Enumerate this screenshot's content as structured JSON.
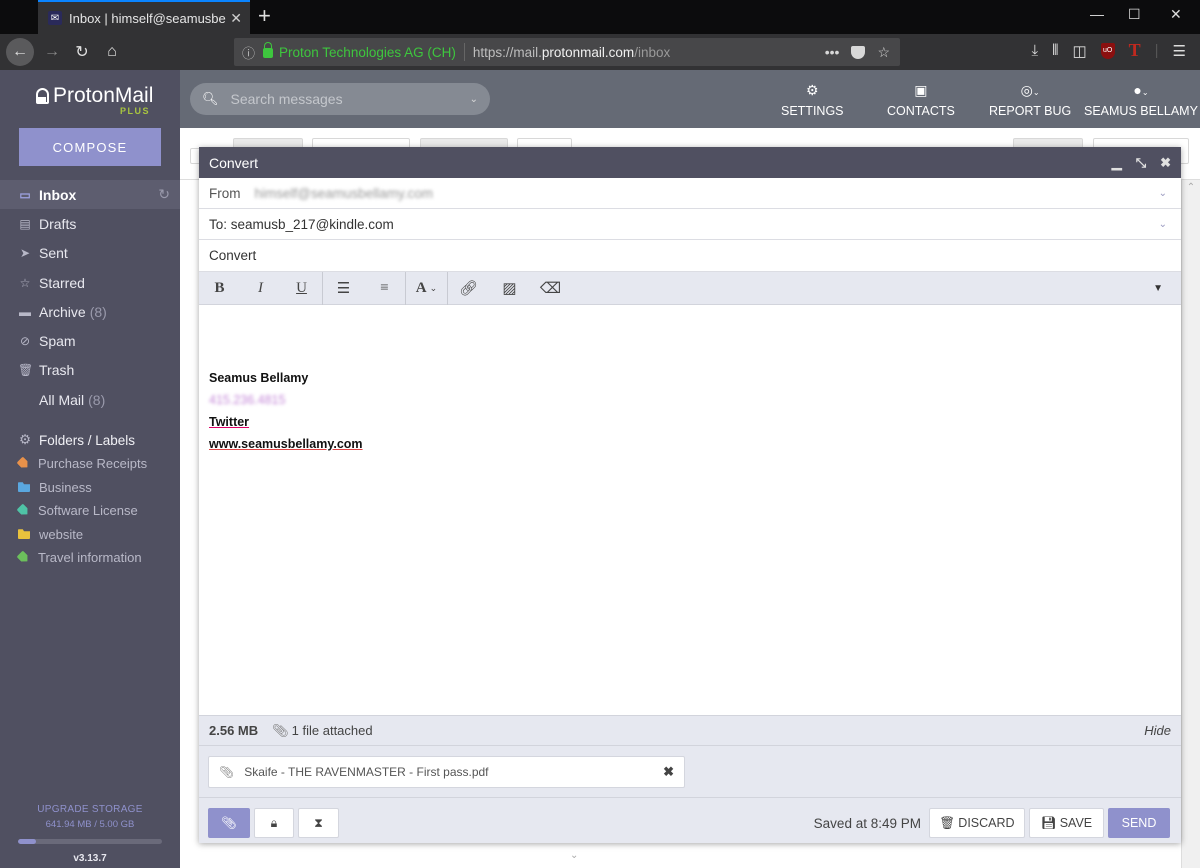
{
  "browser": {
    "tab_title": "Inbox | himself@seamusbellamy.com",
    "tab_close": "✕",
    "new_tab": "+",
    "url_info_icon": "ⓘ",
    "url_org": "Proton Technologies AG (CH)",
    "url_prefix": "https://mail.",
    "url_domain": "protonmail.com",
    "url_path": "/inbox",
    "url_more": "•••",
    "window": {
      "minimize": "—",
      "maximize": "☐",
      "close": "✕"
    }
  },
  "app": {
    "logo_text": "ProtonMail",
    "plan": "PLUS",
    "compose_label": "COMPOSE",
    "search_placeholder": "Search messages",
    "header_nav": [
      {
        "label": "SETTINGS",
        "icon": "gears-icon"
      },
      {
        "label": "CONTACTS",
        "icon": "address-book-icon"
      },
      {
        "label": "REPORT BUG",
        "icon": "lifebuoy-icon"
      },
      {
        "label": "SEAMUS BELLAMY",
        "icon": "user-icon"
      }
    ],
    "sidebar": {
      "items": [
        {
          "label": "Inbox",
          "icon": "inbox-icon",
          "count": ""
        },
        {
          "label": "Drafts",
          "icon": "drafts-icon",
          "count": ""
        },
        {
          "label": "Sent",
          "icon": "paper-plane-icon",
          "count": ""
        },
        {
          "label": "Starred",
          "icon": "star-icon",
          "count": ""
        },
        {
          "label": "Archive",
          "icon": "archive-icon",
          "count": "(8)"
        },
        {
          "label": "Spam",
          "icon": "ban-icon",
          "count": ""
        },
        {
          "label": "Trash",
          "icon": "trash-icon",
          "count": ""
        },
        {
          "label": "All Mail",
          "icon": "",
          "count": "(8)"
        }
      ],
      "labels_heading": "Folders / Labels",
      "labels": [
        {
          "name": "Purchase Receipts",
          "type": "label",
          "color": "#e8914a"
        },
        {
          "name": "Business",
          "type": "folder",
          "color": "#5aa7df"
        },
        {
          "name": "Software License",
          "type": "label",
          "color": "#4fc3a6"
        },
        {
          "name": "website",
          "type": "folder",
          "color": "#e9c23d"
        },
        {
          "name": "Travel information",
          "type": "label",
          "color": "#6cbf5c"
        }
      ],
      "storage": {
        "upgrade_label": "UPGRADE STORAGE",
        "usage": "641.94 MB / 5.00 GB",
        "used_fraction": 0.1254,
        "version": "v3.13.7"
      }
    },
    "composer": {
      "title": "Convert",
      "from_label": "From",
      "from_value": "himself@seamusbellamy.com",
      "to_value": "To: seamusb_217@kindle.com",
      "subject": "Convert",
      "format_buttons": [
        "B",
        "I",
        "U"
      ],
      "body": {
        "signature_name": "Seamus Bellamy",
        "signature_phone": "415.236.4815",
        "signature_twitter": "Twitter",
        "signature_site": "www.seamusbellamy.com"
      },
      "attachment_size": "2.56 MB",
      "attachment_count": "1 file attached",
      "hide_label": "Hide",
      "attachment_name": "Skaife - THE RAVENMASTER - First pass.pdf",
      "saved_status": "Saved at 8:49 PM",
      "discard_label": "DISCARD",
      "save_label": "SAVE",
      "send_label": "SEND"
    }
  },
  "colors": {
    "accent": "#8f91cc",
    "sidebar_bg": "#505061",
    "header_bg": "#656a75",
    "plus_green": "#a8c43f"
  }
}
